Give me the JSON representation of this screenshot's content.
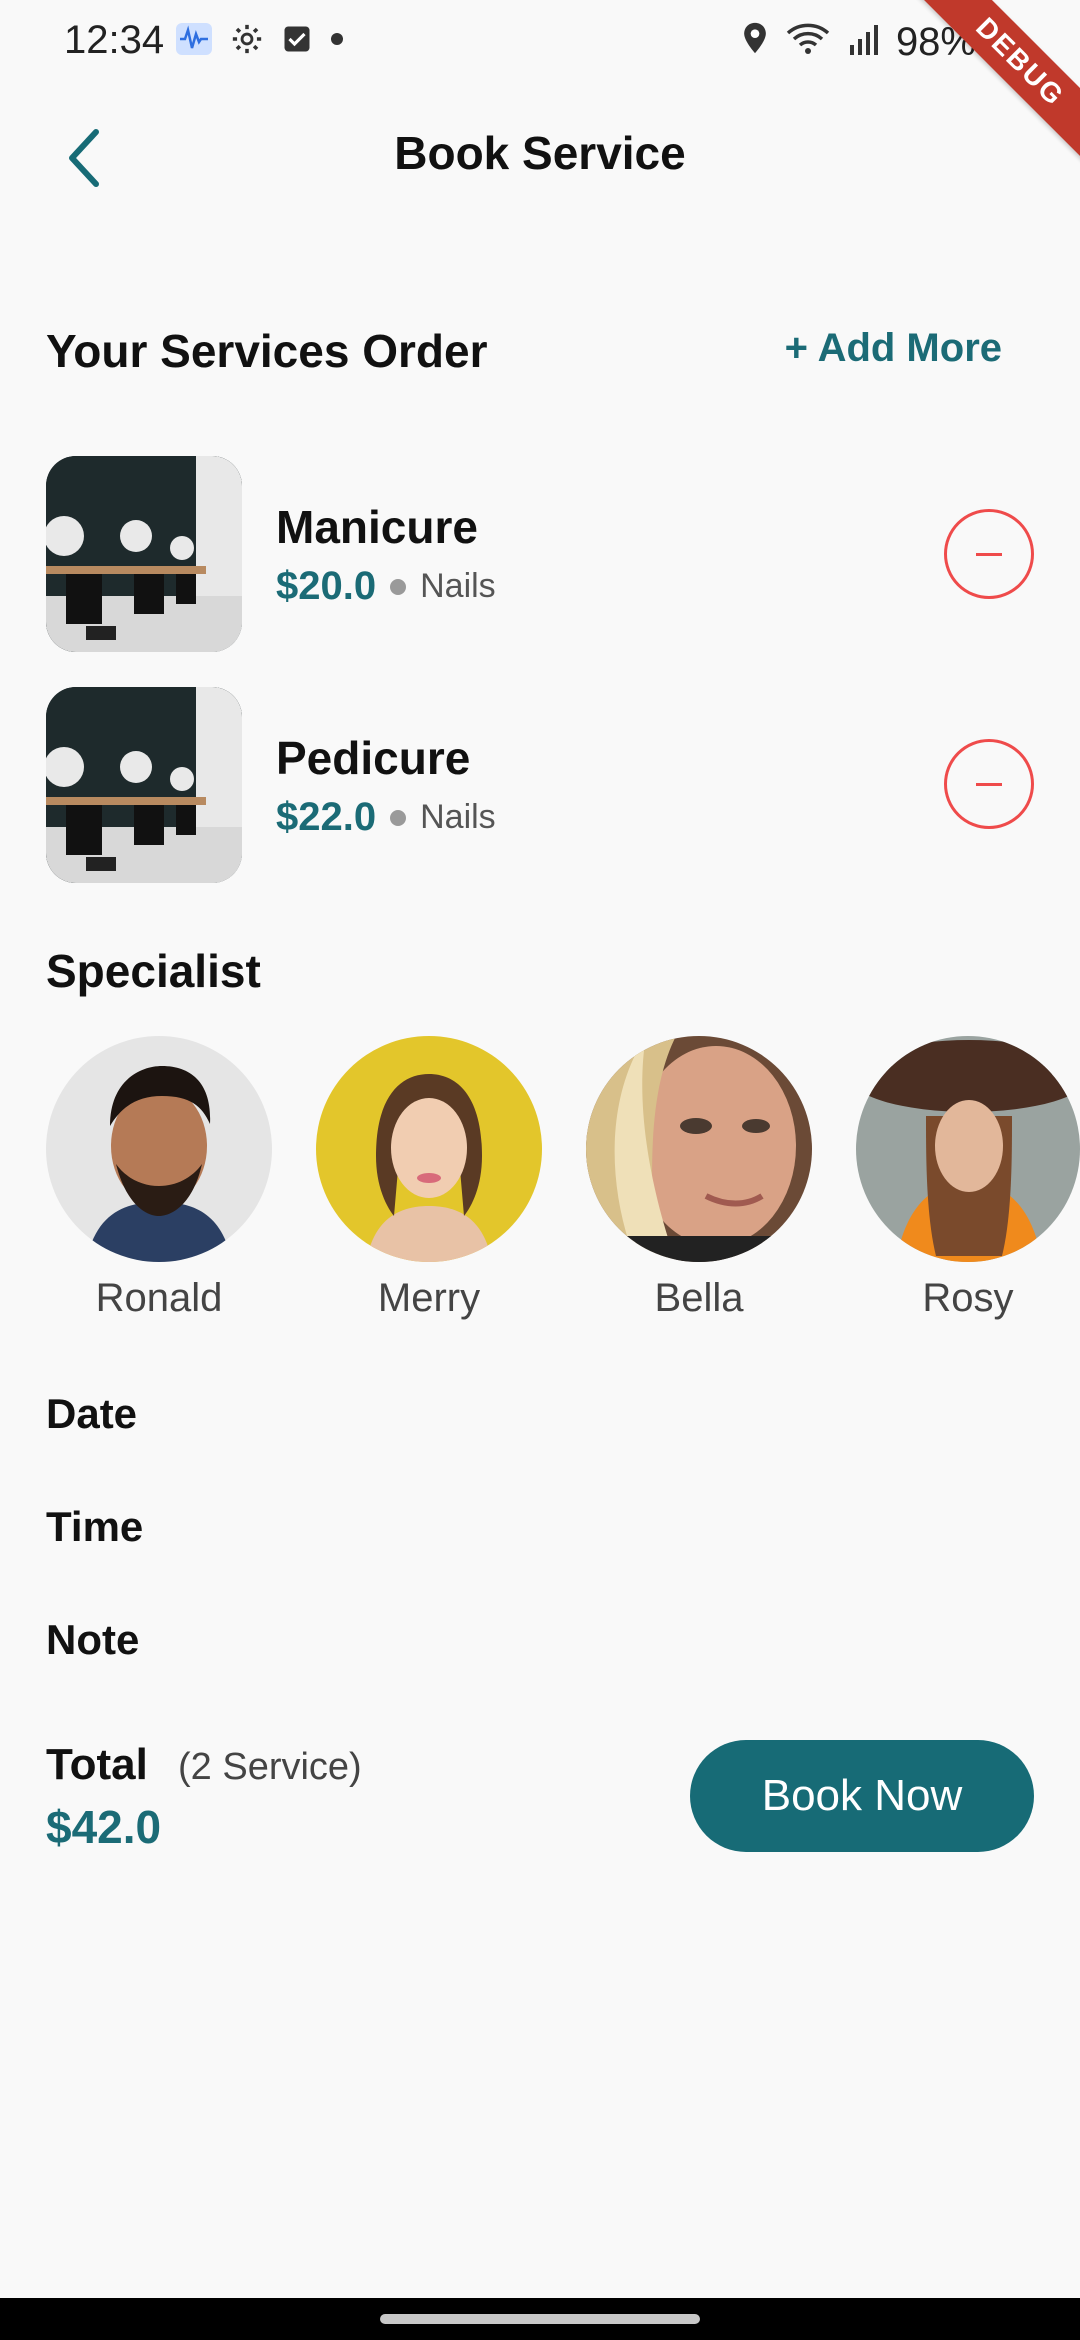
{
  "status_bar": {
    "time": "12:34",
    "battery": "98%",
    "debug_label": "DEBUG",
    "icons": [
      "sound-wave-icon",
      "gear-icon",
      "checkbox-icon",
      "dot-icon",
      "location-icon",
      "wifi-icon",
      "signal-icon",
      "battery-icon"
    ]
  },
  "header": {
    "title": "Book Service",
    "back_icon": "chevron-left-icon"
  },
  "order": {
    "title": "Your Services Order",
    "add_more": "+ Add More",
    "items": [
      {
        "name": "Manicure",
        "price": "$20.0",
        "category": "Nails"
      },
      {
        "name": "Pedicure",
        "price": "$22.0",
        "category": "Nails"
      }
    ]
  },
  "specialist": {
    "title": "Specialist",
    "people": [
      {
        "name": "Ronald"
      },
      {
        "name": "Merry"
      },
      {
        "name": "Bella"
      },
      {
        "name": "Rosy"
      }
    ]
  },
  "fields": {
    "date": "Date",
    "time": "Time",
    "note": "Note"
  },
  "footer": {
    "total_label": "Total",
    "total_count": "(2 Service)",
    "total_amount": "$42.0",
    "book_button": "Book Now"
  },
  "colors": {
    "accent": "#1b6b76",
    "remove": "#ef4b4b",
    "background": "#f9f9f9"
  }
}
